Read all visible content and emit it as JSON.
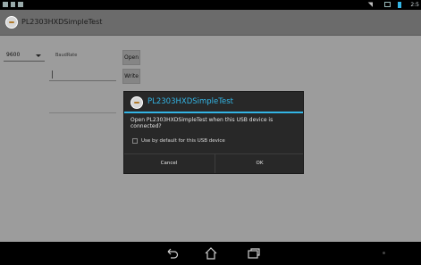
{
  "status_bar": {
    "time": "2:5"
  },
  "app": {
    "title": "PL2303HXDSimpleTest",
    "baud_value": "9600",
    "baud_label": "BaudRate",
    "open_label": "Open",
    "write_label": "Write",
    "write_value": ""
  },
  "dialog": {
    "title": "PL2303HXDSimpleTest",
    "message": "Open PL2303HXDSimpleTest when this USB device is connected?",
    "checkbox_label": "Use by default for this USB device",
    "cancel_label": "Cancel",
    "ok_label": "OK"
  },
  "nav": {
    "icons": [
      "back-icon",
      "home-icon",
      "recent-apps-icon",
      "menu-icon"
    ]
  },
  "colors": {
    "accent": "#33b5e5",
    "dialog_bg": "#282828",
    "dim_bg": "#9c9c9c"
  }
}
